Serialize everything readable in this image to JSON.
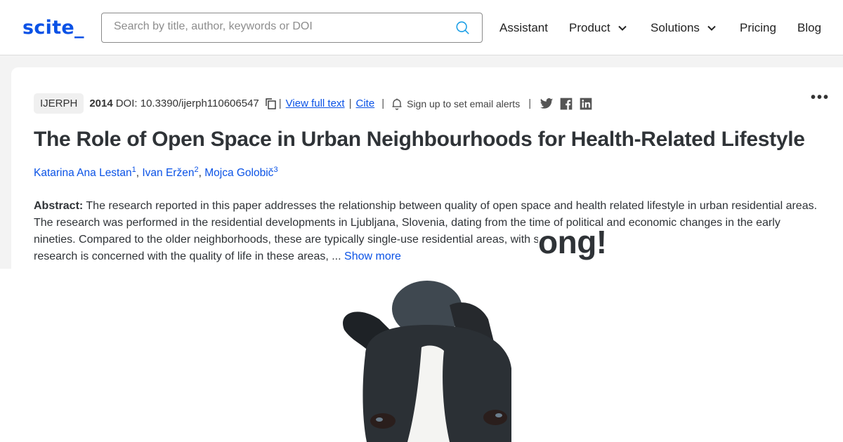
{
  "header": {
    "logo": "scite_",
    "search_placeholder": "Search by title, author, keywords or DOI",
    "search_icon": "search-icon",
    "nav": [
      {
        "label": "Assistant",
        "dropdown": false
      },
      {
        "label": "Product",
        "dropdown": true
      },
      {
        "label": "Solutions",
        "dropdown": true
      },
      {
        "label": "Pricing",
        "dropdown": false
      },
      {
        "label": "Blog",
        "dropdown": false
      }
    ]
  },
  "paper": {
    "journal": "IJERPH",
    "year": "2014",
    "doi": "DOI: 10.3390/ijerph110606547",
    "copy_icon": "copy-icon",
    "view_full_text": "View full text",
    "cite": "Cite",
    "alert_text": "Sign up to set email alerts",
    "social": [
      "twitter-icon",
      "facebook-icon",
      "linkedin-icon"
    ],
    "more_menu": "•••",
    "title": "The Role of Open Space in Urban Neighbourhoods for Health-Related Lifestyle",
    "authors": [
      {
        "name": "Katarina Ana Lestan",
        "sup": "1"
      },
      {
        "name": "Ivan Eržen",
        "sup": "2"
      },
      {
        "name": "Mojca Golobič",
        "sup": "3"
      }
    ],
    "abstract_label": "Abstract:",
    "abstract_text": "The research reported in this paper addresses the relationship between quality of open space and health related lifestyle in urban residential areas. The research was performed in the residential developments in Ljubljana, Slovenia, dating from the time of political and economic changes in the early nineties. Compared to the older neighborhoods, these are typically single-use residential areas, with s",
    "abstract_tail": "research is concerned with the quality of life in these areas, ...",
    "show_more": "Show more"
  },
  "overlay": {
    "text": "ong!",
    "image": "boston-terrier-dog-photo"
  }
}
